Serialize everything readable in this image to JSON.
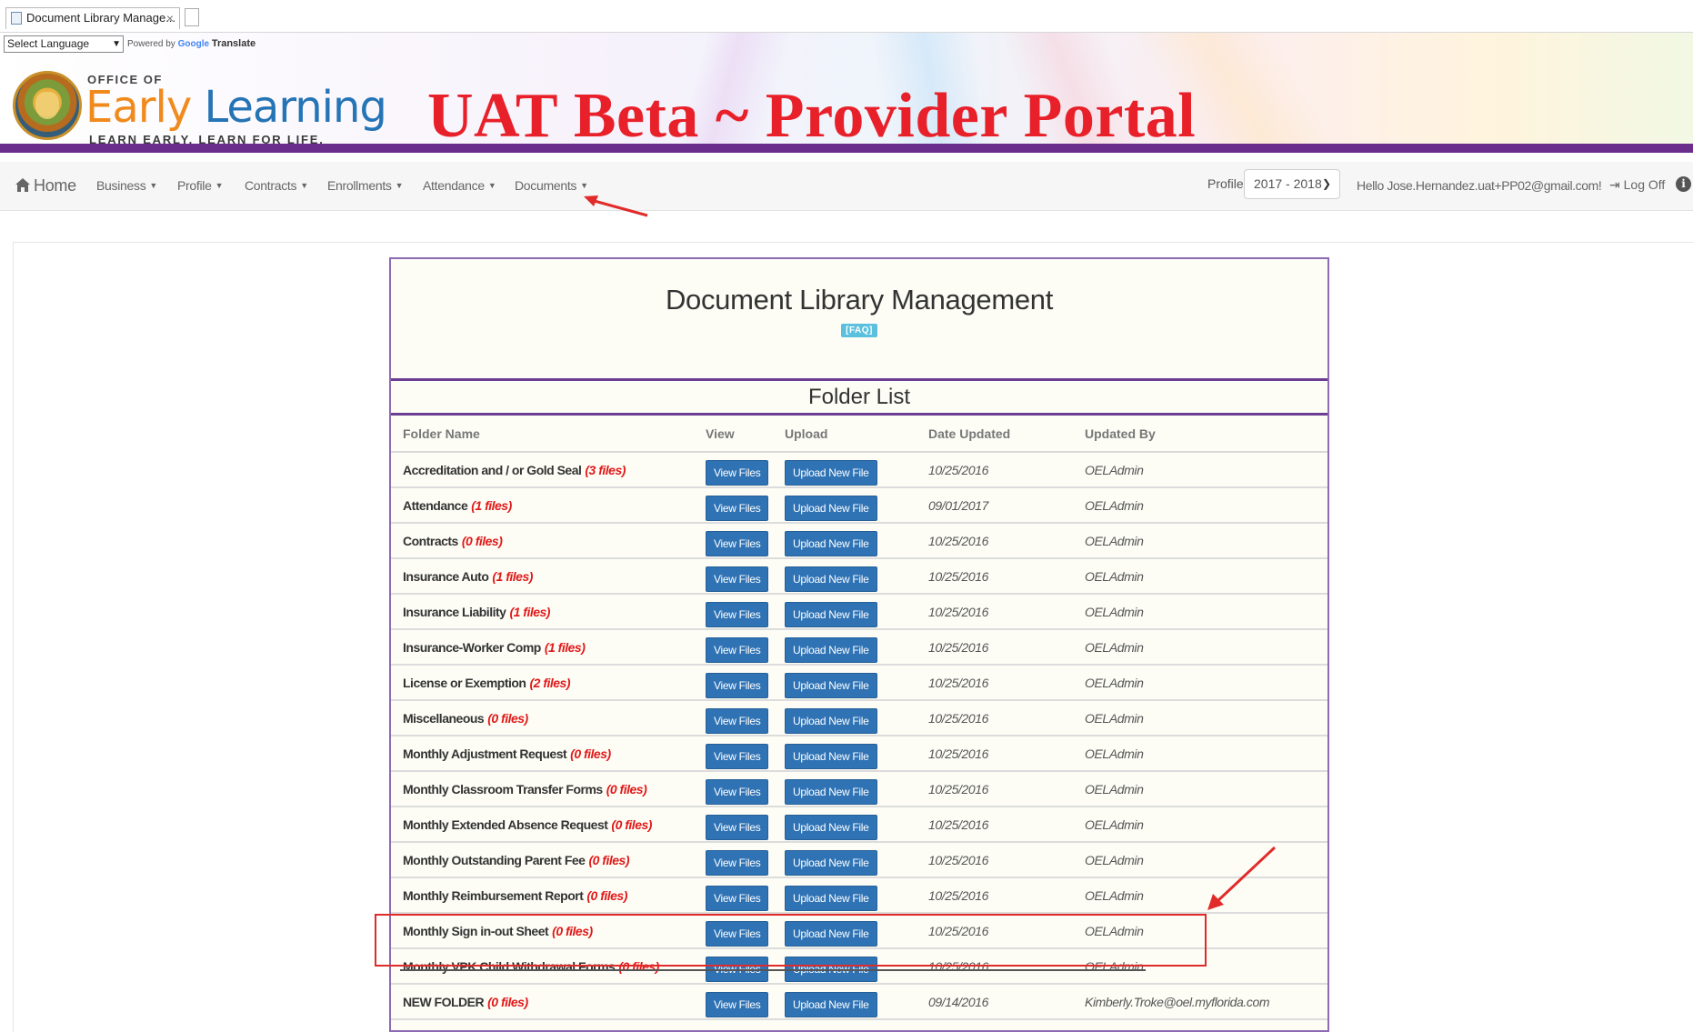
{
  "browser": {
    "tab_title": "Document Library Manage...",
    "tab_close": "×"
  },
  "header": {
    "language_select": "Select Language",
    "powered_by_prefix": "Powered by",
    "powered_by_google": "Google",
    "powered_by_suffix": "Translate",
    "logo_office": "OFFICE OF",
    "logo_early": "Early",
    "logo_learning": "Learning",
    "logo_tagline": "LEARN EARLY. LEARN FOR LIFE.",
    "portal_title": "UAT Beta ~ Provider Portal",
    "brand_purple": "#6b2d8c",
    "title_red": "#e8202a"
  },
  "nav": {
    "home": "Home",
    "items": [
      "Business",
      "Profile",
      "Contracts",
      "Enrollments",
      "Attendance",
      "Documents"
    ],
    "profile_label": "Profile:",
    "profile_value": "2017 - 2018",
    "greeting": "Hello Jose.Hernandez.uat+PP02@gmail.com!",
    "logoff": "Log Off"
  },
  "page": {
    "title": "Document Library Management",
    "faq": "[FAQ]",
    "folder_list_title": "Folder List",
    "columns": [
      "Folder Name",
      "View",
      "Upload",
      "Date Updated",
      "Updated By"
    ],
    "view_button": "View Files",
    "upload_button": "Upload New File",
    "rows": [
      {
        "name": "Accreditation and / or Gold Seal",
        "count": "(3 files)",
        "date": "10/25/2016",
        "by": "OELAdmin"
      },
      {
        "name": "Attendance",
        "count": "(1 files)",
        "date": "09/01/2017",
        "by": "OELAdmin"
      },
      {
        "name": "Contracts",
        "count": "(0 files)",
        "date": "10/25/2016",
        "by": "OELAdmin"
      },
      {
        "name": "Insurance Auto",
        "count": "(1 files)",
        "date": "10/25/2016",
        "by": "OELAdmin"
      },
      {
        "name": "Insurance Liability",
        "count": "(1 files)",
        "date": "10/25/2016",
        "by": "OELAdmin"
      },
      {
        "name": "Insurance-Worker Comp",
        "count": "(1 files)",
        "date": "10/25/2016",
        "by": "OELAdmin"
      },
      {
        "name": "License or Exemption",
        "count": "(2 files)",
        "date": "10/25/2016",
        "by": "OELAdmin"
      },
      {
        "name": "Miscellaneous",
        "count": "(0 files)",
        "date": "10/25/2016",
        "by": "OELAdmin"
      },
      {
        "name": "Monthly Adjustment Request",
        "count": "(0 files)",
        "date": "10/25/2016",
        "by": "OELAdmin"
      },
      {
        "name": "Monthly Classroom Transfer Forms",
        "count": "(0 files)",
        "date": "10/25/2016",
        "by": "OELAdmin"
      },
      {
        "name": "Monthly Extended Absence Request",
        "count": "(0 files)",
        "date": "10/25/2016",
        "by": "OELAdmin"
      },
      {
        "name": "Monthly Outstanding Parent Fee",
        "count": "(0 files)",
        "date": "10/25/2016",
        "by": "OELAdmin"
      },
      {
        "name": "Monthly Reimbursement Report",
        "count": "(0 files)",
        "date": "10/25/2016",
        "by": "OELAdmin"
      },
      {
        "name": "Monthly Sign in-out Sheet",
        "count": "(0 files)",
        "date": "10/25/2016",
        "by": "OELAdmin"
      },
      {
        "name": "Monthly VPK Child Withdrawal Forms",
        "count": "(0 files)",
        "date": "10/25/2016",
        "by": "OELAdmin"
      },
      {
        "name": "NEW FOLDER",
        "count": "(0 files)",
        "date": "09/14/2016",
        "by": "Kimberly.Troke@oel.myflorida.com"
      }
    ]
  }
}
